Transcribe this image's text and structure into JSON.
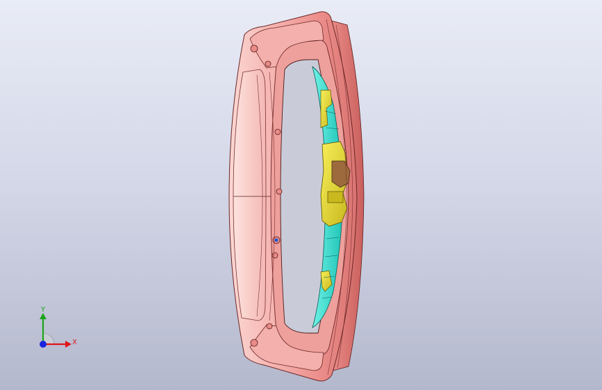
{
  "app": {
    "view": "cad-3d-model-viewport"
  },
  "triad": {
    "x_label": "X",
    "y_label": "Y",
    "x_color": "#e0141a",
    "y_color": "#1aa51a",
    "z_color": "#1a24e0"
  },
  "model": {
    "part_icon": "tailgate-inner-panel-icon",
    "shell_color": "#f2a4a4",
    "shell_edge_color": "#6b2626",
    "fixture_color": "#2fe0d0",
    "bracket_color": "#e8e02a"
  }
}
